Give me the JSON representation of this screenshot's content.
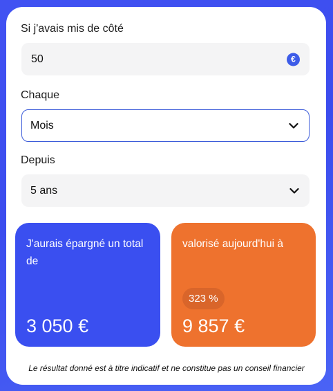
{
  "form": {
    "amount_label": "Si j'avais mis de côté",
    "amount_value": "50",
    "currency_icon": "euro-icon",
    "frequency_label": "Chaque",
    "frequency_value": "Mois",
    "duration_label": "Depuis",
    "duration_value": "5 ans"
  },
  "results": {
    "saved_title": "J'aurais épargné un total de",
    "saved_amount": "3 050 €",
    "valued_title": "valorisé aujourd'hui à",
    "valued_percent": "323 %",
    "valued_amount": "9 857 €"
  },
  "disclaimer": "Le résultat donné est à titre indicatif et ne constitue pas un conseil financier",
  "colors": {
    "background": "#3b4ef0",
    "saved_card": "#3a4ff0",
    "valued_card": "#ee722e",
    "focus_border": "#3b5bd9"
  }
}
